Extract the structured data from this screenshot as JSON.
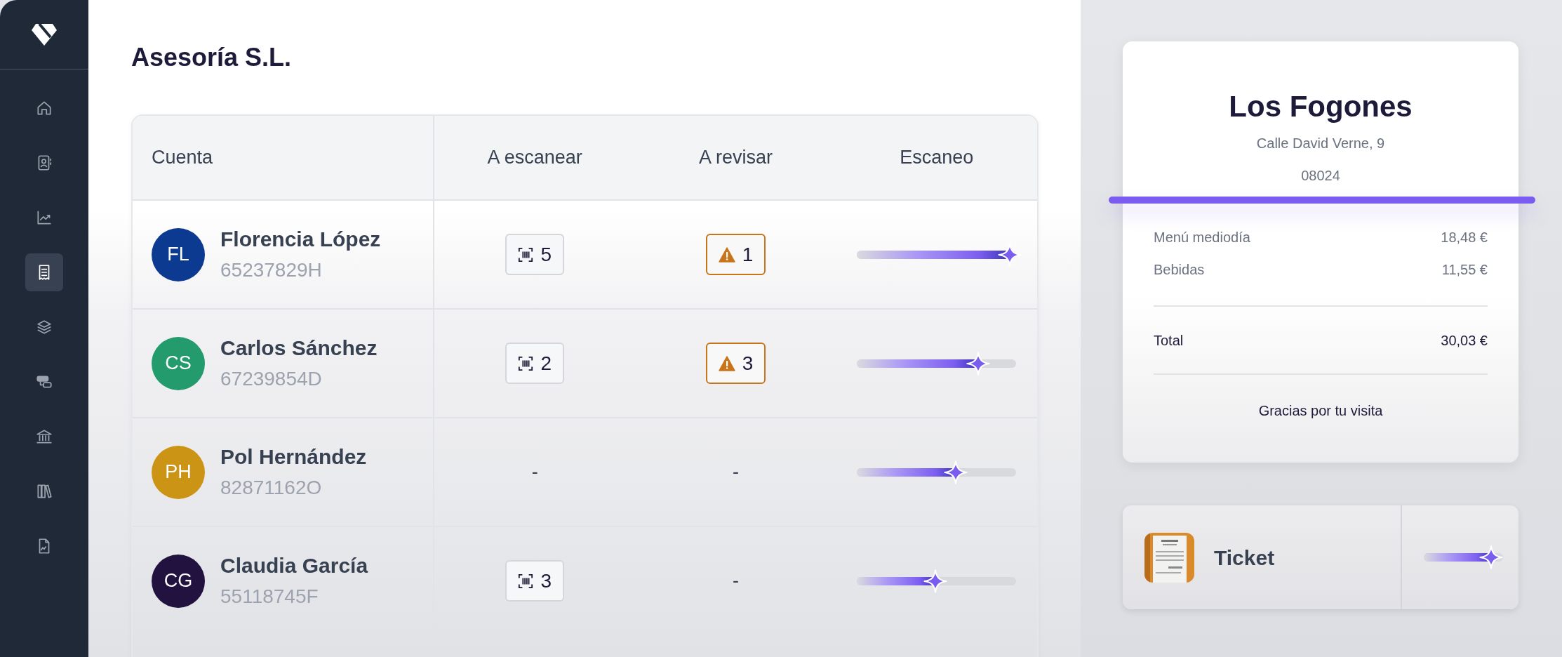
{
  "sidebar": {
    "items": [
      {
        "selected": false
      },
      {
        "selected": false
      },
      {
        "selected": false
      },
      {
        "selected": true
      },
      {
        "selected": false
      },
      {
        "selected": false
      },
      {
        "selected": false
      },
      {
        "selected": false
      },
      {
        "selected": false
      }
    ]
  },
  "page": {
    "title": "Asesoría S.L."
  },
  "table": {
    "columns": [
      "Cuenta",
      "A escanear",
      "A revisar",
      "Escaneo"
    ],
    "rows": [
      {
        "initials": "FL",
        "color": "#0c3a91",
        "name": "Florencia López",
        "id_number": "65237829H",
        "to_scan": {
          "kind": "badge",
          "value": "5"
        },
        "to_review": {
          "kind": "warning",
          "value": "1"
        },
        "level": 0.96
      },
      {
        "initials": "CS",
        "color": "#239b6c",
        "name": "Carlos Sánchez",
        "id_number": "67239854D",
        "to_scan": {
          "kind": "badge",
          "value": "2"
        },
        "to_review": {
          "kind": "warning",
          "value": "3"
        },
        "level": 0.76
      },
      {
        "initials": "PH",
        "color": "#cc9414",
        "name": "Pol Hernández",
        "id_number": "82871162O",
        "to_scan": {
          "kind": "none",
          "value": "-"
        },
        "to_review": {
          "kind": "none",
          "value": "-"
        },
        "level": 0.62
      },
      {
        "initials": "CG",
        "color": "#21123f",
        "name": "Claudia García",
        "id_number": "55118745F",
        "to_scan": {
          "kind": "badge",
          "value": "3"
        },
        "to_review": {
          "kind": "none",
          "value": "-"
        },
        "level": 0.49
      }
    ]
  },
  "receipt": {
    "merchant": "Los Fogones",
    "address": "Calle David Verne, 9",
    "postcode": "08024",
    "items": [
      {
        "label": "Menú mediodía",
        "amount": "18,48 €"
      },
      {
        "label": "Bebidas",
        "amount": "11,55 €"
      }
    ],
    "total": {
      "label": "Total",
      "amount": "30,03 €"
    },
    "footer": "Gracias por tu visita"
  },
  "ticket": {
    "label": "Ticket",
    "level": 0.85
  }
}
